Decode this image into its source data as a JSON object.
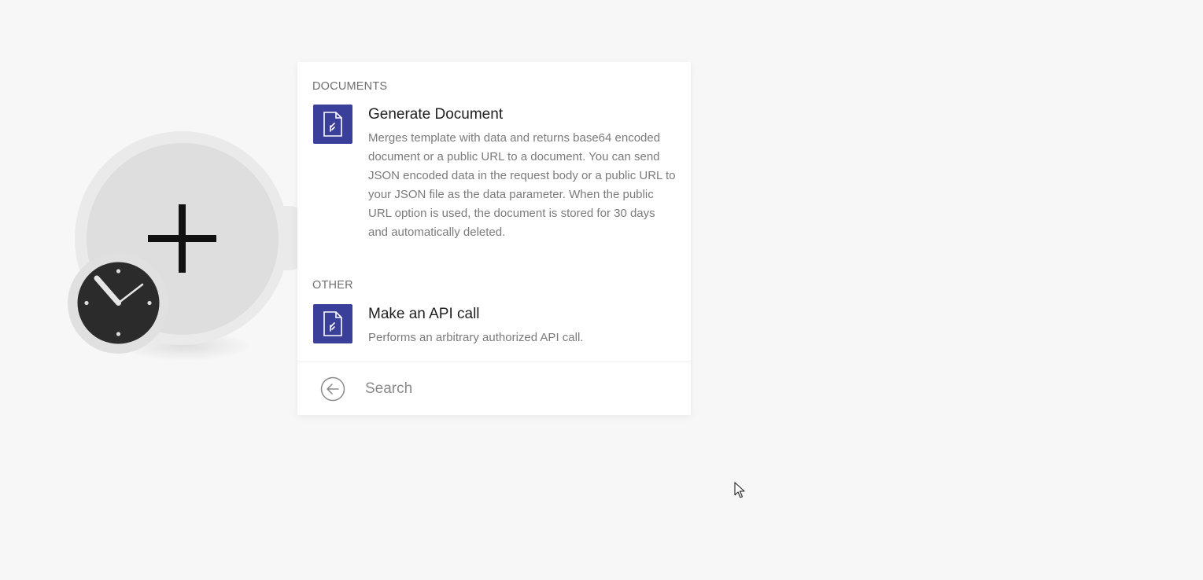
{
  "module": {
    "action_icon": "plus-icon",
    "trigger_icon": "clock-icon"
  },
  "menu": {
    "sections": [
      {
        "title": "DOCUMENTS",
        "items": [
          {
            "icon": "document-icon",
            "title": "Generate Document",
            "description": "Merges template with data and returns base64 encoded document or a public URL to a document. You can send JSON encoded data in the request body or a public URL to your JSON file as the data parameter. When the public URL option is used, the document is stored for 30 days and automatically deleted."
          }
        ]
      },
      {
        "title": "OTHER",
        "items": [
          {
            "icon": "document-icon",
            "title": "Make an API call",
            "description": "Performs an arbitrary authorized API call."
          }
        ]
      }
    ],
    "search": {
      "back_icon": "back-arrow-icon",
      "placeholder": "Search"
    }
  },
  "colors": {
    "background": "#f7f7f7",
    "app_icon": "#3a3f99",
    "panel": "#ffffff"
  }
}
